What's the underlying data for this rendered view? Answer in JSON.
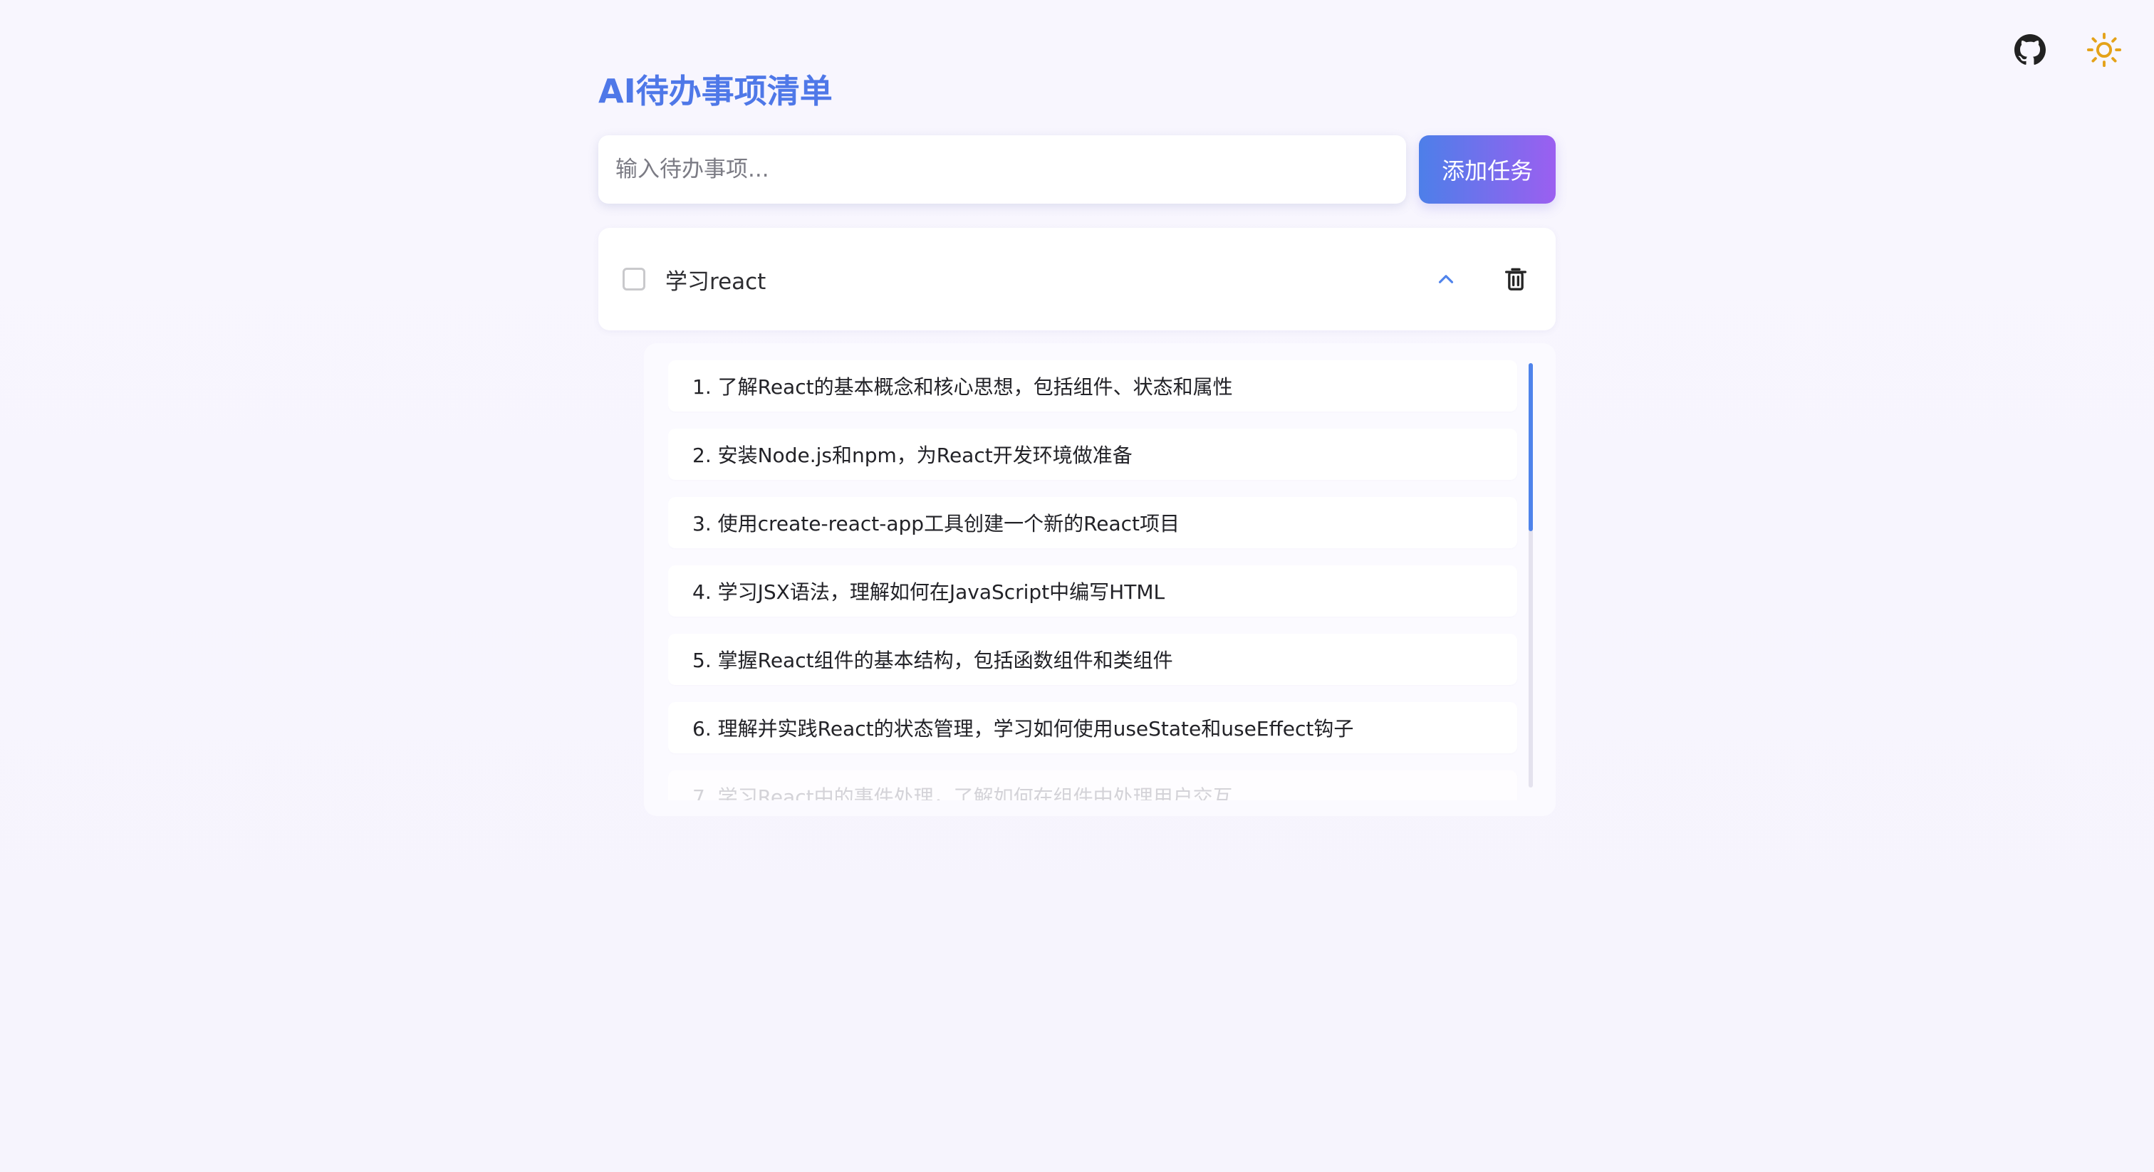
{
  "app": {
    "title": "AI待办事项清单"
  },
  "top_icons": [
    {
      "name": "github-icon"
    },
    {
      "name": "sun-icon"
    }
  ],
  "input": {
    "placeholder": "输入待办事项...",
    "value": ""
  },
  "buttons": {
    "add_task": "添加任务"
  },
  "task": {
    "text": "学习react",
    "checked": false
  },
  "subtasks": [
    "1. 了解React的基本概念和核心思想，包括组件、状态和属性",
    "2. 安装Node.js和npm，为React开发环境做准备",
    "3. 使用create-react-app工具创建一个新的React项目",
    "4. 学习JSX语法，理解如何在JavaScript中编写HTML",
    "5. 掌握React组件的基本结构，包括函数组件和类组件",
    "6. 理解并实践React的状态管理，学习如何使用useState和useEffect钩子",
    "7. 学习React中的事件处理，了解如何在组件中处理用户交互"
  ],
  "colors": {
    "background": "#f7f5fd",
    "title": "#4f78e8",
    "accent_start": "#4d7fe9",
    "accent_end": "#9b5ff0",
    "sun": "#e4a219",
    "chevron": "#4f83eb"
  }
}
